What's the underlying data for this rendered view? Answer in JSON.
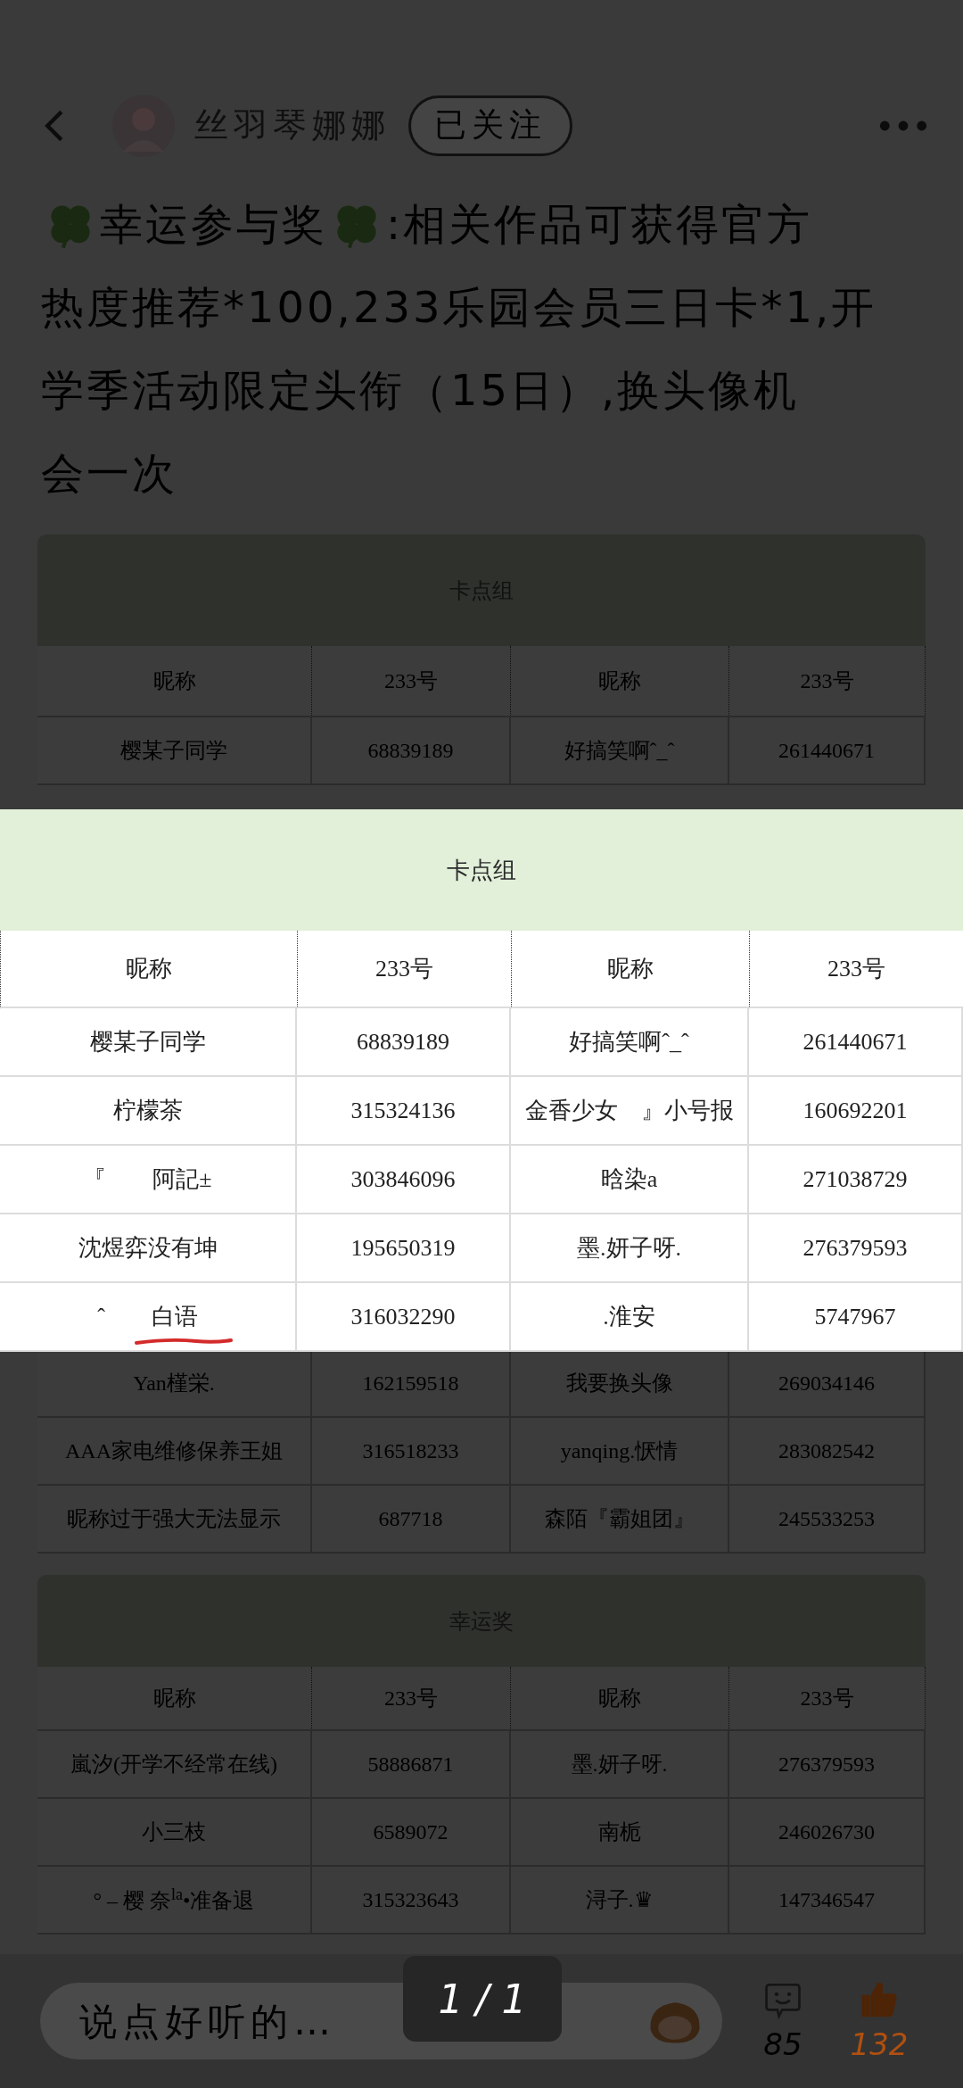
{
  "header": {
    "author": "丝羽琴娜娜",
    "follow_button": "已关注"
  },
  "post": {
    "title": "幸运参与奖",
    "lines": [
      ":相关作品可获得官方",
      "热度推荐*100,233乐园会员三日卡*1,开",
      "学季活动限定头衔（15日）,换头像机",
      "会一次"
    ]
  },
  "tables": [
    {
      "title": "卡点组",
      "columns": [
        "昵称",
        "233号",
        "昵称",
        "233号"
      ],
      "rows_above": [
        [
          "樱某子同学",
          "68839189",
          "好搞笑啊ˆ_ˆ",
          "261440671"
        ]
      ],
      "rows_below": [
        [
          "Yan槿栄.",
          "162159518",
          "我要换头像",
          "269034146"
        ],
        [
          "AAA家电维修保养王姐",
          "316518233",
          "yanqing.恹情",
          "283082542"
        ],
        [
          "昵称过于强大无法显示",
          "687718",
          "森陌『霸姐团』",
          "245533253"
        ]
      ]
    },
    {
      "title": "幸运奖",
      "columns": [
        "昵称",
        "233号",
        "昵称",
        "233号"
      ],
      "rows_above": [
        [
          "嵐汐(开学不经常在线)",
          "58886871",
          "墨.妍子呀.",
          "276379593"
        ],
        [
          "小三枝",
          "6589072",
          "南栀",
          "246026730"
        ],
        [
          "°  – 樱 奈$^{la}$•准备退",
          "315323643",
          "浔子.♛",
          "147346547"
        ]
      ]
    }
  ],
  "image_viewer": {
    "title": "卡点组",
    "columns": [
      "昵称",
      "233号",
      "昵称",
      "233号"
    ],
    "rows": [
      {
        "cells": [
          "樱某子同学",
          "68839189",
          "好搞笑啊ˆ_ˆ",
          "261440671"
        ],
        "underlined": false
      },
      {
        "cells": [
          "柠檬茶",
          "315324136",
          "金香少女　』小号报",
          "160692201"
        ],
        "underlined": false
      },
      {
        "cells": [
          "『　　阿記±",
          "303846096",
          "晗染a",
          "271038729"
        ],
        "underlined": false
      },
      {
        "cells": [
          "沈煜弈没有坤",
          "195650319",
          "墨.妍子呀.",
          "276379593"
        ],
        "underlined": false
      },
      {
        "cells": [
          "ˆ　　白语",
          "316032290",
          ".淮安",
          "5747967"
        ],
        "underlined": true
      }
    ],
    "page_indicator": "1 / 1"
  },
  "comment_bar": {
    "placeholder": "说点好听的…",
    "comments": "85",
    "likes": "132",
    "liked": true
  }
}
